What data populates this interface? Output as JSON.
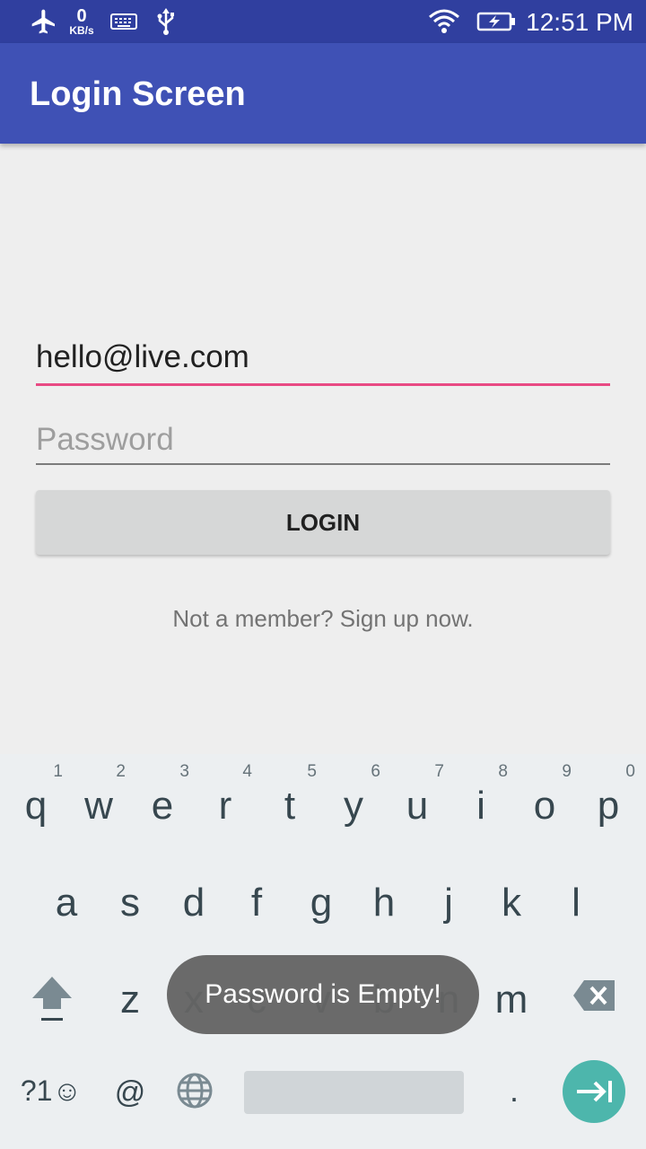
{
  "status_bar": {
    "network_speed_value": "0",
    "network_speed_unit": "KB/s",
    "time": "12:51 PM",
    "icons": [
      "airplane-icon",
      "keyboard-icon",
      "usb-icon",
      "wifi-icon",
      "battery-charging-icon"
    ]
  },
  "app_bar": {
    "title": "Login Screen",
    "color": "#3f51b5",
    "status_color": "#303f9f"
  },
  "form": {
    "email_value": "hello@live.com",
    "password_placeholder": "Password",
    "login_label": "LOGIN",
    "signup_text": "Not a member? Sign up now.",
    "accent_color": "#e84a83"
  },
  "keyboard": {
    "row1": [
      {
        "key": "q",
        "hint": "1"
      },
      {
        "key": "w",
        "hint": "2"
      },
      {
        "key": "e",
        "hint": "3"
      },
      {
        "key": "r",
        "hint": "4"
      },
      {
        "key": "t",
        "hint": "5"
      },
      {
        "key": "y",
        "hint": "6"
      },
      {
        "key": "u",
        "hint": "7"
      },
      {
        "key": "i",
        "hint": "8"
      },
      {
        "key": "o",
        "hint": "9"
      },
      {
        "key": "p",
        "hint": "0"
      }
    ],
    "row2": [
      "a",
      "s",
      "d",
      "f",
      "g",
      "h",
      "j",
      "k",
      "l"
    ],
    "row3": [
      "z",
      "x",
      "c",
      "v",
      "b",
      "n",
      "m"
    ],
    "symbols_label": "?1☺",
    "at_label": "@",
    "period_label": ".",
    "enter_color": "#4db6ac"
  },
  "toast": {
    "message": "Password is Empty!"
  }
}
